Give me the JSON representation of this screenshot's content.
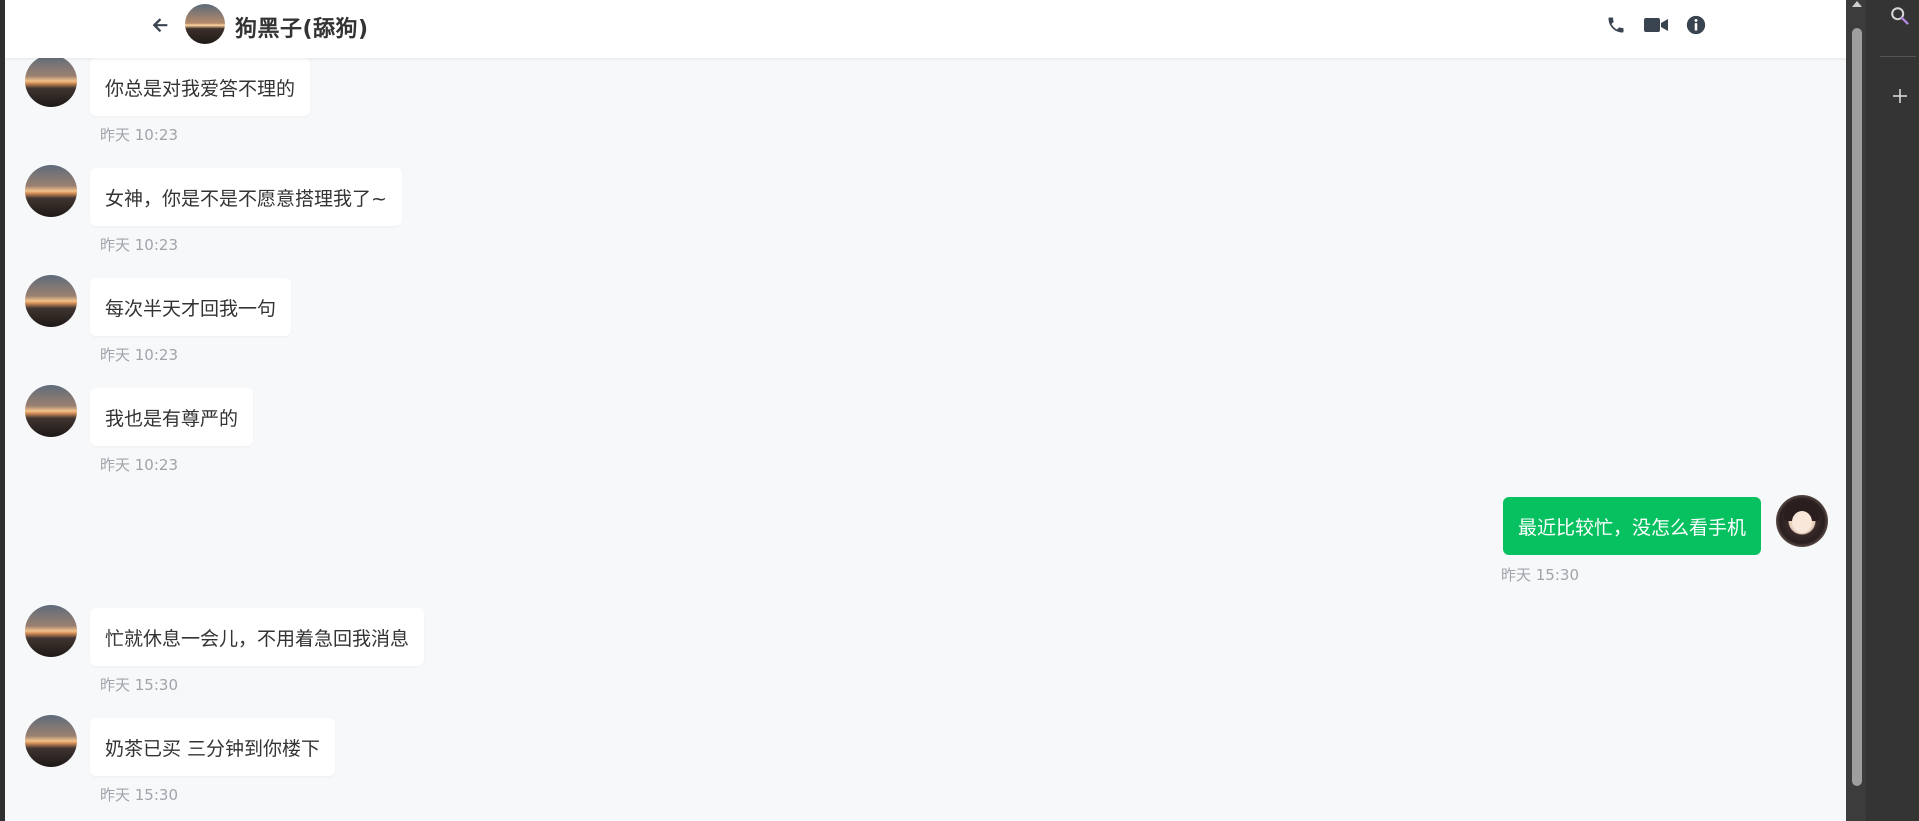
{
  "header": {
    "title": "狗黑子(舔狗)",
    "icons": [
      "back-arrow-icon",
      "phone-icon",
      "video-camera-icon",
      "info-icon"
    ]
  },
  "messages": [
    {
      "from": "friend",
      "text": "你总是对我爱答不理的",
      "time": "昨天 10:23"
    },
    {
      "from": "friend",
      "text": "女神，你是不是不愿意搭理我了~",
      "time": "昨天 10:23"
    },
    {
      "from": "friend",
      "text": "每次半天才回我一句",
      "time": "昨天 10:23"
    },
    {
      "from": "friend",
      "text": "我也是有尊严的",
      "time": "昨天 10:23"
    },
    {
      "from": "me",
      "text": "最近比较忙，没怎么看手机",
      "time": "昨天 15:30"
    },
    {
      "from": "friend",
      "text": "忙就休息一会儿，不用着急回我消息",
      "time": "昨天 15:30"
    },
    {
      "from": "friend",
      "text": "奶茶已买 三分钟到你楼下",
      "time": "昨天 15:30"
    }
  ],
  "side_panel": {
    "icons": [
      "search-icon",
      "plus-icon"
    ]
  },
  "colors": {
    "accent_green": "#07c160",
    "chat_background": "#f7f8fa",
    "header_background": "#ffffff",
    "icon_dark": "#3a4451",
    "timestamp": "#a0a4aa"
  }
}
